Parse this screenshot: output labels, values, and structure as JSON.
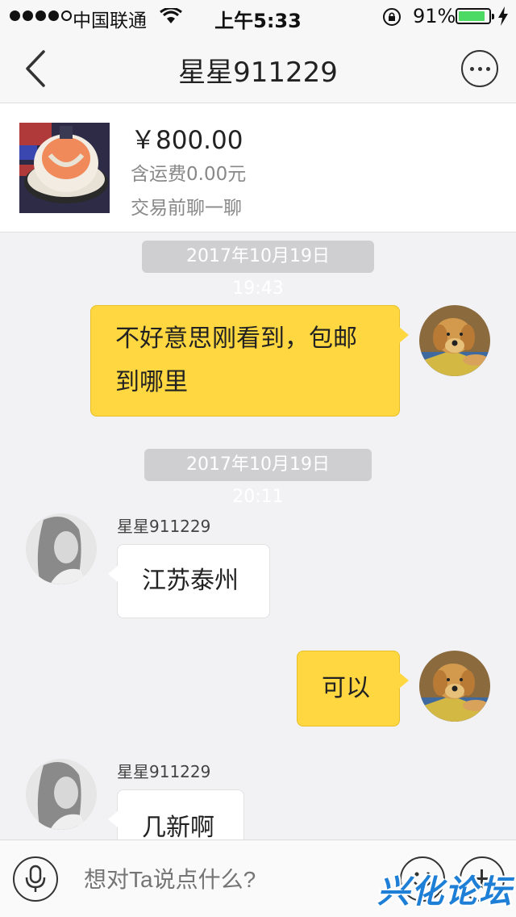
{
  "status_bar": {
    "carrier": "中国联通",
    "time": "上午5:33",
    "battery": "91%",
    "battery_level": 0.91
  },
  "nav": {
    "title": "星星911229"
  },
  "product": {
    "price": "￥800.00",
    "shipping": "含运费0.00元",
    "hint": "交易前聊一聊"
  },
  "messages": [
    {
      "type": "timestamp",
      "text": "2017年10月19日 19:43"
    },
    {
      "type": "me",
      "text": "不好意思刚看到，包邮到哪里"
    },
    {
      "type": "timestamp",
      "text": "2017年10月19日 20:11"
    },
    {
      "type": "them",
      "sender": "星星911229",
      "text": "江苏泰州"
    },
    {
      "type": "me",
      "text": "可以"
    },
    {
      "type": "them",
      "sender": "星星911229",
      "text": "几新啊"
    }
  ],
  "input": {
    "placeholder": "想对Ta说点什么?"
  },
  "watermark": "兴化论坛",
  "colors": {
    "my_bubble": "#ffd740",
    "their_bubble": "#ffffff",
    "timestamp_bg": "#cfcfd2",
    "battery": "#4cd964"
  },
  "icons": [
    "back-icon",
    "more-icon",
    "microphone-icon",
    "emoji-icon",
    "plus-icon"
  ]
}
